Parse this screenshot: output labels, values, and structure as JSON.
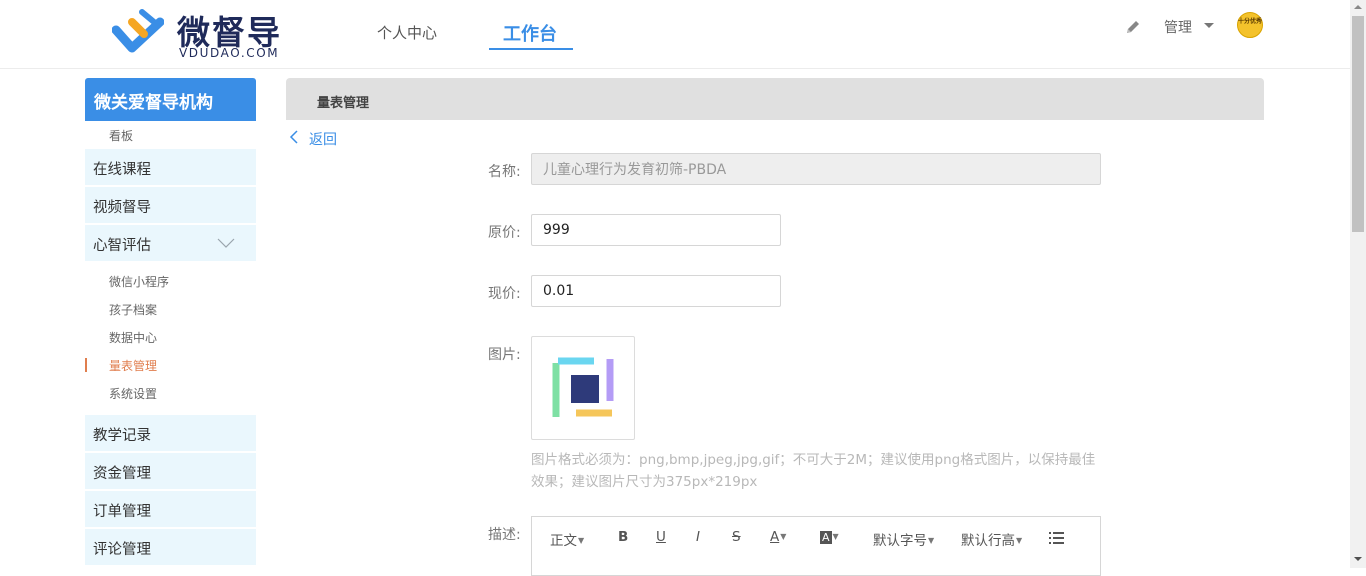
{
  "header": {
    "logo_title": "微督导",
    "logo_sub": "VDUDAO.COM",
    "tabs": [
      "个人中心",
      "工作台"
    ],
    "admin_label": "管理",
    "avatar_text": "十分优秀"
  },
  "sidebar": {
    "org_name": "微关爱督导机构",
    "board_label": "看板",
    "items": {
      "online_course": "在线课程",
      "video_supervision": "视频督导",
      "assessment": "心智评估",
      "teaching_records": "教学记录",
      "finance": "资金管理",
      "orders": "订单管理",
      "comments": "评论管理"
    },
    "sub_items": [
      "微信小程序",
      "孩子档案",
      "数据中心",
      "量表管理",
      "系统设置"
    ]
  },
  "main": {
    "panel_title": "量表管理",
    "back_label": "返回",
    "form": {
      "name_label": "名称:",
      "name_value": "儿童心理行为发育初筛-PBDA",
      "orig_price_label": "原价:",
      "orig_price_value": "999",
      "cur_price_label": "现价:",
      "cur_price_value": "0.01",
      "image_label": "图片:",
      "image_hint": "图片格式必须为：png,bmp,jpeg,jpg,gif；不可大于2M；建议使用png格式图片，以保持最佳效果；建议图片尺寸为375px*219px",
      "desc_label": "描述:"
    },
    "toolbar": {
      "paragraph": "正文",
      "bold": "B",
      "underline": "U",
      "italic": "I",
      "strike": "S",
      "font_color": "A",
      "bg_color": "A",
      "font_size": "默认字号",
      "line_height": "默认行高"
    }
  },
  "colors": {
    "primary": "#3a8ee6",
    "active": "#e07e4e",
    "sidebar_bg": "#eaf7fd"
  },
  "icons": [
    "logo-icon",
    "pencil-icon",
    "chevron-down-icon",
    "back-arrow-icon",
    "list-icon"
  ]
}
